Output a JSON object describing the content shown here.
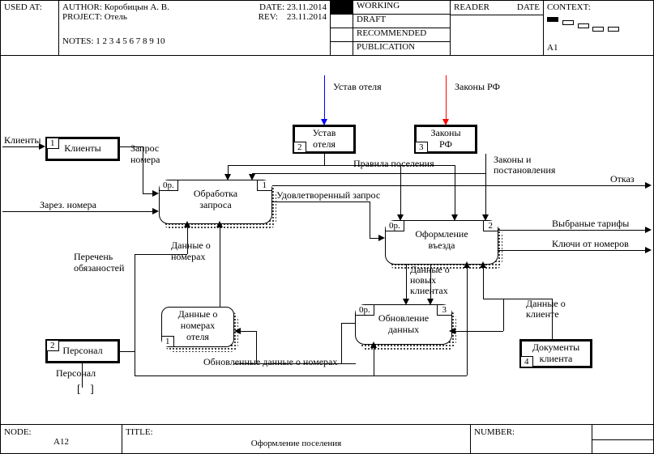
{
  "header": {
    "usedAt": "USED AT:",
    "author_label": "AUTHOR:",
    "author": "Коробицын А. В.",
    "project_label": "PROJECT:",
    "project": "Отель",
    "date_label": "DATE:",
    "date": "23.11.2014",
    "rev_label": "REV:",
    "rev": "23.11.2014",
    "notes_label": "NOTES:",
    "notes": "1  2  3  4  5  6  7  8  9  10",
    "working": "WORKING",
    "draft": "DRAFT",
    "recommended": "RECOMMENDED",
    "publication": "PUBLICATION",
    "reader": "READER",
    "hdrdate": "DATE",
    "context": "CONTEXT:",
    "context_ref": "A1"
  },
  "footer": {
    "node_label": "NODE:",
    "node": "A12",
    "title_label": "TITLE:",
    "title": "Оформление поселения",
    "number_label": "NUMBER:"
  },
  "ext": {
    "clients_num": "1",
    "clients": "Клиенты",
    "personal_num": "2",
    "personal": "Персонал",
    "ustav_num": "2",
    "ustav_l1": "Устав",
    "ustav_l2": "отеля",
    "zakony_num": "3",
    "zakony_l1": "Законы",
    "zakony_l2": "РФ",
    "docs_num": "4",
    "docs_l1": "Документы",
    "docs_l2": "клиента"
  },
  "act": {
    "a1_op": "0р.",
    "a1_num": "1",
    "a1_l1": "Обработка",
    "a1_l2": "запроса",
    "a2_op": "0р.",
    "a2_num": "2",
    "a2_l1": "Оформление",
    "a2_l2": "въезда",
    "a3_op": "0р.",
    "a3_num": "3",
    "a3_l1": "Обновление",
    "a3_l2": "данных",
    "rooms_num": "1",
    "rooms_l1": "Данные о",
    "rooms_l2": "номерах",
    "rooms_l3": "отеля"
  },
  "labels": {
    "ustav_top": "Устав отеля",
    "zakony_top": "Законы РФ",
    "zapros": "Запрос",
    "nomera": "номера",
    "zarez": "Зарез. номера",
    "perechen_l1": "Перечень",
    "perechen_l2": "обязаностей",
    "personal": "Персонал",
    "pravila": "Правила поселения",
    "zak_post_l1": "Законы и",
    "zak_post_l2": "постановления",
    "udov": "Удовлетворенный запрос",
    "otkaz": "Отказ",
    "tarify": "Выбраные тарифы",
    "kluchi": "Ключи от номеров",
    "dan_nom_l1": "Данные о",
    "dan_nom_l2": "номерах",
    "dan_new_l1": "Данные о",
    "dan_new_l2": "новых",
    "dan_new_l3": "клиентах",
    "dan_klient_l1": "Данные о",
    "dan_klient_l2": "клиенте",
    "obnov": "Обновленные данные о номерах"
  }
}
